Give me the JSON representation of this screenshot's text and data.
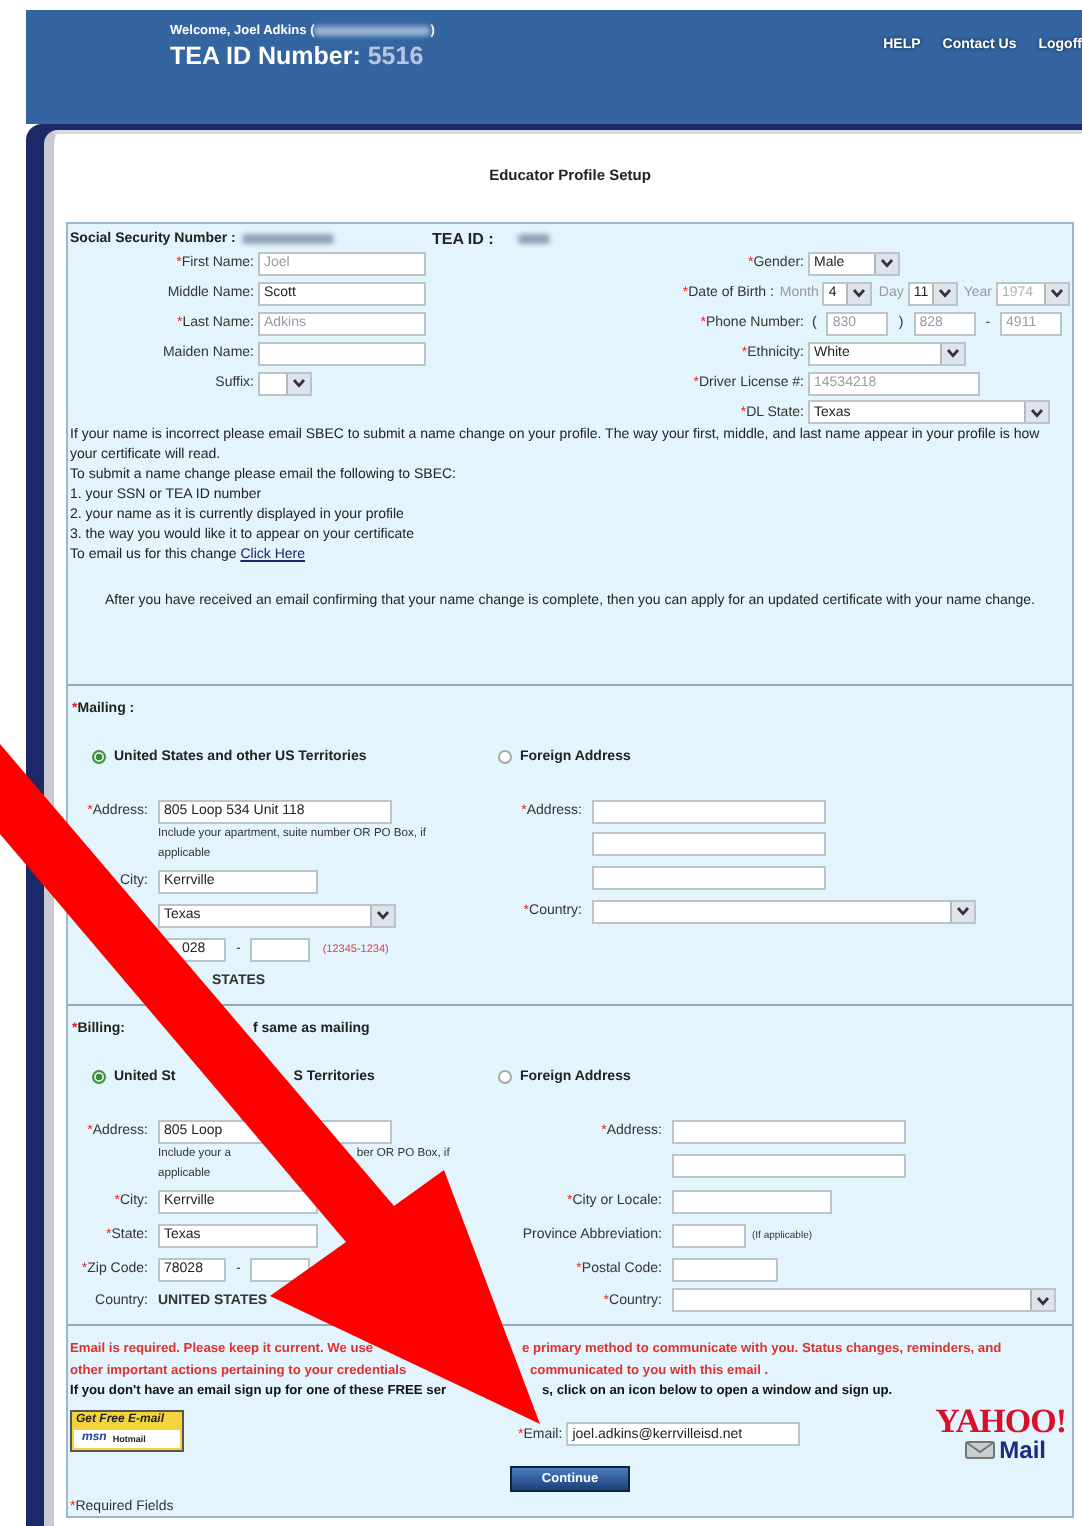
{
  "header": {
    "welcome": "Welcome, Joel Adkins (",
    "welcome_close": ")",
    "id_label": "TEA ID Number:",
    "id_value": "5516",
    "links": [
      "HELP",
      "Contact Us",
      "Logoff"
    ]
  },
  "title": "Educator Profile Setup",
  "profile": {
    "ssn_label": "Social Security Number :",
    "tea_id_label": "TEA ID :",
    "left": [
      {
        "kind": "text",
        "asterisk": "*",
        "label": "First Name:",
        "value": "Joel",
        "disabled": true
      },
      {
        "kind": "text",
        "label": "Middle Name:",
        "value": "Scott",
        "disabled": false
      },
      {
        "kind": "text",
        "asterisk": "*",
        "label": "Last Name:",
        "value": "Adkins",
        "disabled": true
      },
      {
        "kind": "text",
        "label": "Maiden Name:"
      },
      {
        "kind": "tiny",
        "label": "Suffix:"
      }
    ],
    "right": [
      {
        "kind": "select",
        "asterisk": "*",
        "label": "Gender:",
        "value": "Male"
      },
      {
        "kind": "date",
        "asterisk": "*",
        "label": "Date of Birth :",
        "parts": [
          {
            "caption": "Month",
            "value": "4",
            "disabled": false
          },
          {
            "caption": "Day",
            "value": "11",
            "disabled": false
          },
          {
            "caption": "Year",
            "value": "1974",
            "disabled": true
          }
        ]
      },
      {
        "kind": "phone",
        "asterisk": "*",
        "label": "Phone Number:",
        "open": "(",
        "close": ")",
        "dash": "-",
        "values": [
          "830",
          "828",
          "4911"
        ],
        "disabled": true
      },
      {
        "kind": "select",
        "asterisk": "*",
        "label": "Ethnicity:",
        "value": "White"
      },
      {
        "kind": "text",
        "asterisk": "*",
        "label": "Driver License #:",
        "value": "14534218",
        "disabled": true
      },
      {
        "kind": "wideselect",
        "asterisk": "*",
        "label": "DL State:",
        "value": "Texas"
      }
    ],
    "notice": [
      "If your name is incorrect please email SBEC to submit a name change on your profile. The way your first, middle, and last name appear in your profile is how your certificate will read.",
      "To submit a name change please email the following to SBEC:",
      "1. your SSN or TEA ID number",
      "2. your name as it is currently displayed in your profile",
      "3. the way you would like it to appear on your certificate"
    ],
    "email_prompt": "To email us for this change",
    "email_link": "Click Here",
    "after": "After you have received an email confirming that your name change is complete, then you can apply for an updated certificate with your name change."
  },
  "mailing": {
    "asterisk": "*",
    "title": "Mailing :",
    "options": [
      {
        "parts": [
          "United States and other US Territories"
        ],
        "selected": true
      },
      {
        "parts": [
          "Foreign Address"
        ],
        "selected": false
      }
    ],
    "left": [
      {
        "kind": "text",
        "asterisk": "*",
        "label": "Address:",
        "value": "805 Loop 534 Unit 118"
      },
      {
        "kind": "hint",
        "lines": [
          [
            "Include your apartment, suite number OR PO Box, if"
          ],
          [
            "applicable"
          ]
        ]
      },
      {
        "kind": "medium",
        "label": "City:",
        "value": "Kerrville"
      },
      {
        "kind": "select",
        "value": "Texas"
      },
      {
        "kind": "zip",
        "value": "028",
        "dash": "-",
        "format": "(12345-1234)"
      },
      {
        "kind": "static",
        "value": "STATES"
      }
    ],
    "right": [
      {
        "kind": "text",
        "asterisk": "*",
        "label": "Address:"
      },
      {
        "kind": "text"
      },
      {
        "kind": "text"
      },
      {
        "kind": "wideselect",
        "asterisk": "*",
        "label": "Country:"
      }
    ]
  },
  "billing": {
    "asterisk": "*",
    "title": "Billing:",
    "same_as": "f same as mailing",
    "options": [
      {
        "parts": [
          "United St",
          "S Territories"
        ],
        "selected": true
      },
      {
        "parts": [
          "Foreign Address"
        ],
        "selected": false
      }
    ],
    "left": [
      {
        "kind": "text",
        "asterisk": "*",
        "label": "Address:",
        "value": "805 Loop"
      },
      {
        "kind": "hint",
        "lines": [
          [
            "Include your a",
            "ber OR PO Box, if"
          ],
          [
            "applicable"
          ]
        ]
      },
      {
        "kind": "medium",
        "asterisk": "*",
        "label": "City:",
        "value": "Kerrville"
      },
      {
        "kind": "medium",
        "asterisk": "*",
        "label": "State:",
        "value": "Texas"
      },
      {
        "kind": "zip",
        "asterisk": "*",
        "label": "Zip Code:",
        "value": "78028",
        "dash": "-"
      },
      {
        "kind": "static",
        "label": "Country:",
        "value": "UNITED STATES"
      }
    ],
    "right": [
      {
        "kind": "text",
        "asterisk": "*",
        "label": "Address:"
      },
      {
        "kind": "text"
      },
      {
        "kind": "medium",
        "asterisk": "*",
        "label": "City or Locale:"
      },
      {
        "kind": "short",
        "label": "Province Abbreviation:",
        "note": "(If applicable)"
      },
      {
        "kind": "postal",
        "asterisk": "*",
        "label": "Postal Code:"
      },
      {
        "kind": "wideselect",
        "asterisk": "*",
        "label": "Country:"
      }
    ]
  },
  "email": {
    "warning": [
      [
        "Email is required. Please keep it current.  We use",
        "e primary method to communicate with you.  Status changes, reminders, and"
      ],
      [
        "other important actions pertaining to your credentials",
        "communicated to you with this email ."
      ]
    ],
    "signup": [
      "If you don't have an email sign up for one of these FREE ser",
      "s, click on an icon below to open a window and sign up."
    ],
    "msn": {
      "tagline": "Get Free E-mail",
      "brand": "msn",
      "product": "Hotmail"
    },
    "asterisk": "*",
    "label": "Email:",
    "value": "joel.adkins@kerrvilleisd.net",
    "yahoo": {
      "brand": "YAHOO!",
      "product": "Mail"
    },
    "button": "Continue",
    "required_asterisk": "*",
    "required_note": "Required Fields"
  }
}
